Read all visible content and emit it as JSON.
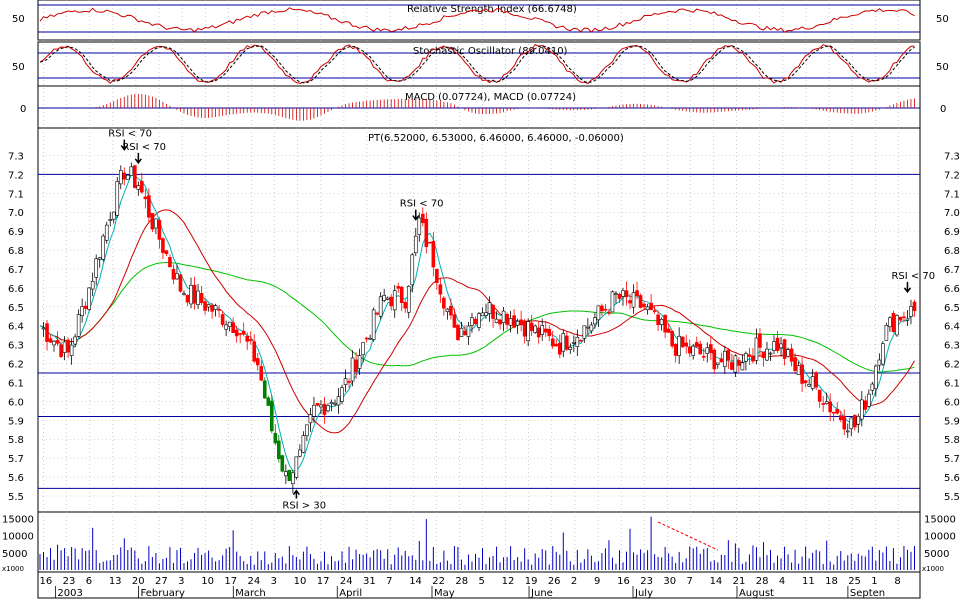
{
  "colors": {
    "background": "#ffffff",
    "frame": "#000000",
    "hline": "#0000a0",
    "grid": "#b0b0b0",
    "price_up": "#ffffff",
    "price_down": "#ff0000",
    "price_down_alt": "#008000",
    "ma_long": "#00c000",
    "ma_mid": "#cc0000",
    "ma_short": "#00b0b0",
    "rsi_line": "#cc0000",
    "stoch_k": "#cc0000",
    "stoch_d": "#000000",
    "macd_hist": "#cc0000",
    "volume": "#0000c0",
    "trend_line": "#ff0000"
  },
  "panels": {
    "rsi": {
      "title": "Relative Strength Index (66.6748)",
      "tick": "50"
    },
    "stoch": {
      "title": "Stochastic Oscillator (89.0410)",
      "tick": "50"
    },
    "macd": {
      "title": "MACD (0.07724), MACD (0.07724)",
      "tick": "0"
    },
    "volume": {
      "unit": "x1000"
    }
  },
  "chart_data": {
    "type": "candlestick",
    "title": "PT(6.52000, 6.53000, 6.46000, 6.46000, -0.06000)",
    "ylim": [
      5.5,
      7.35
    ],
    "y_ticks": [
      "7.3",
      "7.2",
      "7.1",
      "7.0",
      "6.9",
      "6.8",
      "6.7",
      "6.6",
      "6.5",
      "6.4",
      "6.3",
      "6.2",
      "6.1",
      "6.0",
      "5.9",
      "5.8",
      "5.7",
      "5.6",
      "5.5"
    ],
    "horizontal_lines": [
      7.2,
      6.15,
      5.92,
      5.54
    ],
    "x_day_labels": [
      "16",
      "23",
      "6",
      "13",
      "20",
      "27",
      "3",
      "10",
      "17",
      "24",
      "3",
      "10",
      "17",
      "24",
      "31",
      "7",
      "14",
      "22",
      "28",
      "5",
      "12",
      "19",
      "26",
      "2",
      "9",
      "16",
      "23",
      "30",
      "7",
      "14",
      "21",
      "28",
      "4",
      "11",
      "18",
      "25",
      "1",
      "8"
    ],
    "x_month_labels": [
      "2003",
      "February",
      "March",
      "April",
      "May",
      "June",
      "July",
      "August",
      "Septen"
    ],
    "annotations": [
      {
        "text": "RSI < 70",
        "x_index": 24,
        "arrow": "down"
      },
      {
        "text": "RSI < 70",
        "x_index": 28,
        "arrow": "down"
      },
      {
        "text": "RSI < 70",
        "x_index": 107,
        "arrow": "down"
      },
      {
        "text": "RSI > 30",
        "x_index": 73,
        "arrow": "up"
      },
      {
        "text": "RSI < 70",
        "x_index": 247,
        "arrow": "down"
      }
    ],
    "volume_ticks": [
      "15000",
      "10000",
      "5000"
    ],
    "series_summary": {
      "first_close": 6.4,
      "high_jan": 7.27,
      "low_feb": 5.56,
      "high_apr": 7.05,
      "low_aug": 5.84,
      "last": {
        "open": 6.52,
        "high": 6.53,
        "low": 6.46,
        "close": 6.46,
        "change": -0.06
      }
    }
  }
}
